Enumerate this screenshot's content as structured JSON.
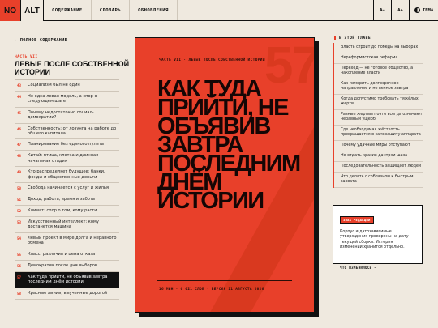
{
  "header": {
    "logo_no": "NO",
    "logo_alt": "ALT",
    "nav": [
      "СОДЕРЖАНИЕ",
      "СЛОВАРЬ",
      "ОБНОВЛЕНИЯ"
    ],
    "font_smaller": "A−",
    "font_larger": "A+",
    "theme": "ТЕМА"
  },
  "sidebar": {
    "back": "← ПОЛНОЕ СОДЕРЖАНИЕ",
    "chapter_num": "ЧАСТЬ VII",
    "chapter_title": "ЛЕВЫЕ ПОСЛЕ СОБСТВЕННОЙ ИСТОРИИ",
    "items": [
      {
        "num": "43",
        "label": "Социализм был не один"
      },
      {
        "num": "44",
        "label": "Не одна левая модель, а спор о следующем шаге"
      },
      {
        "num": "45",
        "label": "Почему недостаточно социал-демократии?"
      },
      {
        "num": "46",
        "label": "Собственность: от лозунга на работе до общего капитала"
      },
      {
        "num": "47",
        "label": "Планирование без единого пульта"
      },
      {
        "num": "48",
        "label": "Китай: птица, клетка и длинная начальная стадия"
      },
      {
        "num": "49",
        "label": "Кто распределяет будущее: банки, фонды и общественные деньги"
      },
      {
        "num": "50",
        "label": "Свобода начинается с услуг и жилья"
      },
      {
        "num": "51",
        "label": "Доход, работа, время и забота"
      },
      {
        "num": "52",
        "label": "Климат: спор о том, кому расти"
      },
      {
        "num": "53",
        "label": "Искусственный интеллект: кому достанется машина"
      },
      {
        "num": "54",
        "label": "Левый проект в мире долга и неравного обмена"
      },
      {
        "num": "55",
        "label": "Класс, различия и цена отказа"
      },
      {
        "num": "56",
        "label": "Демократия после дня выборов"
      },
      {
        "num": "57",
        "label": "Как туда прийти, не объявив завтра последним днём истории"
      },
      {
        "num": "58",
        "label": "Красные линии, выученные дорогой"
      }
    ],
    "active_index": 14
  },
  "poster": {
    "big_number": "57",
    "top_line": "ЧАСТЬ VII  ·  ЛЕВЫЕ ПОСЛЕ СОБСТВЕННОЙ ИСТОРИИ",
    "title": "КАК ТУДА ПРИЙТИ, НЕ ОБЪЯВИВ ЗАВТРА ПОСЛЕДНИМ ДНЁМ ИСТОРИИ",
    "meta": "16 МИН  ·  6 021 СЛОВ  ·  ВЕРСИЯ 11 АВГУСТА 2026"
  },
  "right_panel": {
    "heading": "В ЭТОЙ ГЛАВЕ",
    "items": [
      "Власть строит до победы на выборах",
      "Нереформистская реформа",
      "Переход — не готовое общество, а накопление власти",
      "Как измерить долгосрочное направление и не вечное завтра",
      "Когда допустимо требовать тяжёлых жертв",
      "Равные жертвы почти всегда означают неравный ущерб",
      "Где необходимая жёсткость превращается в самозащиту аппарата",
      "Почему удачные миры отступают",
      "Не отдать красих дантрки шаха",
      "Последовательность защищает людей",
      "Что делать с соблазном к быстрым захвата"
    ],
    "card": {
      "tag": "ЗНАК РЕДАКЦИИ",
      "body": "Корпус и датозависимые утверждения проверены на дату текущей сборки. История изменений хранится отдельно.",
      "link": "ЧТО ИЗМЕНИЛОСЬ →"
    }
  },
  "colors": {
    "accent": "#e8402a",
    "background": "#efe9df",
    "ink": "#111111"
  }
}
